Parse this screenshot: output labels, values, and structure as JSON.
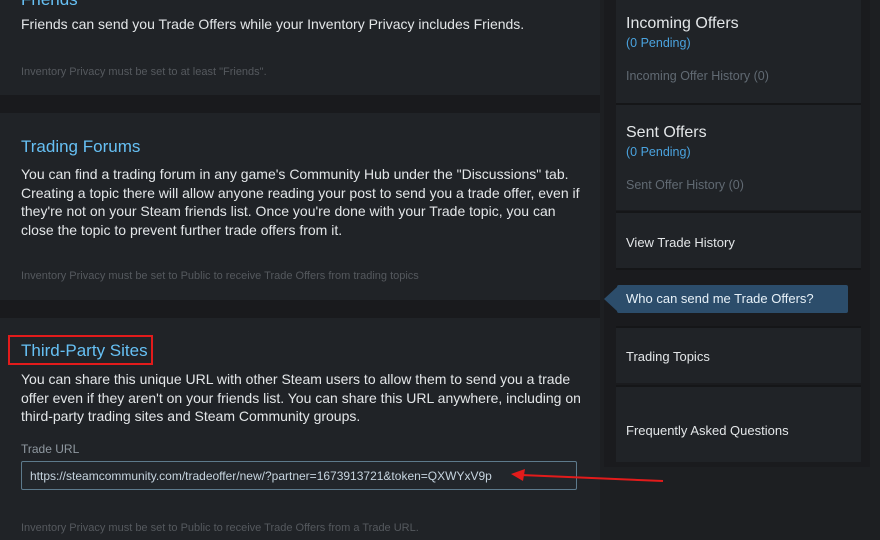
{
  "friends": {
    "title": "Friends",
    "body": "Friends can send you Trade Offers while your Inventory Privacy includes Friends.",
    "note": "Inventory Privacy must be set to at least \"Friends\"."
  },
  "forums": {
    "title": "Trading Forums",
    "body": "You can find a trading forum in any game's Community Hub under the \"Discussions\" tab. Creating a topic there will allow anyone reading your post to send you a trade offer, even if they're not on your Steam friends list. Once you're done with your Trade topic, you can close the topic to prevent further trade offers from it.",
    "note": "Inventory Privacy must be set to Public to receive Trade Offers from trading topics"
  },
  "third_party": {
    "title": "Third-Party Sites",
    "body": "You can share this unique URL with other Steam users to allow them to send you a trade offer even if they aren't on your friends list. You can share this URL anywhere, including on third-party trading sites and Steam Community groups.",
    "url_label": "Trade URL",
    "url_value": "https://steamcommunity.com/tradeoffer/new/?partner=1673913721&token=QXWYxV9p",
    "note": "Inventory Privacy must be set to Public to receive Trade Offers from a Trade URL."
  },
  "sidebar": {
    "incoming_title": "Incoming Offers",
    "incoming_pending": "(0 Pending)",
    "incoming_history": "Incoming Offer History (0)",
    "sent_title": "Sent Offers",
    "sent_pending": "(0 Pending)",
    "sent_history": "Sent Offer History (0)",
    "view_history": "View Trade History",
    "who_can_send": "Who can send me Trade Offers?",
    "trading_topics": "Trading Topics",
    "faq": "Frequently Asked Questions"
  },
  "colors": {
    "accent_link": "#66c0f4",
    "highlight_red": "#e21b1b",
    "active_item": "#2c4d6b"
  }
}
